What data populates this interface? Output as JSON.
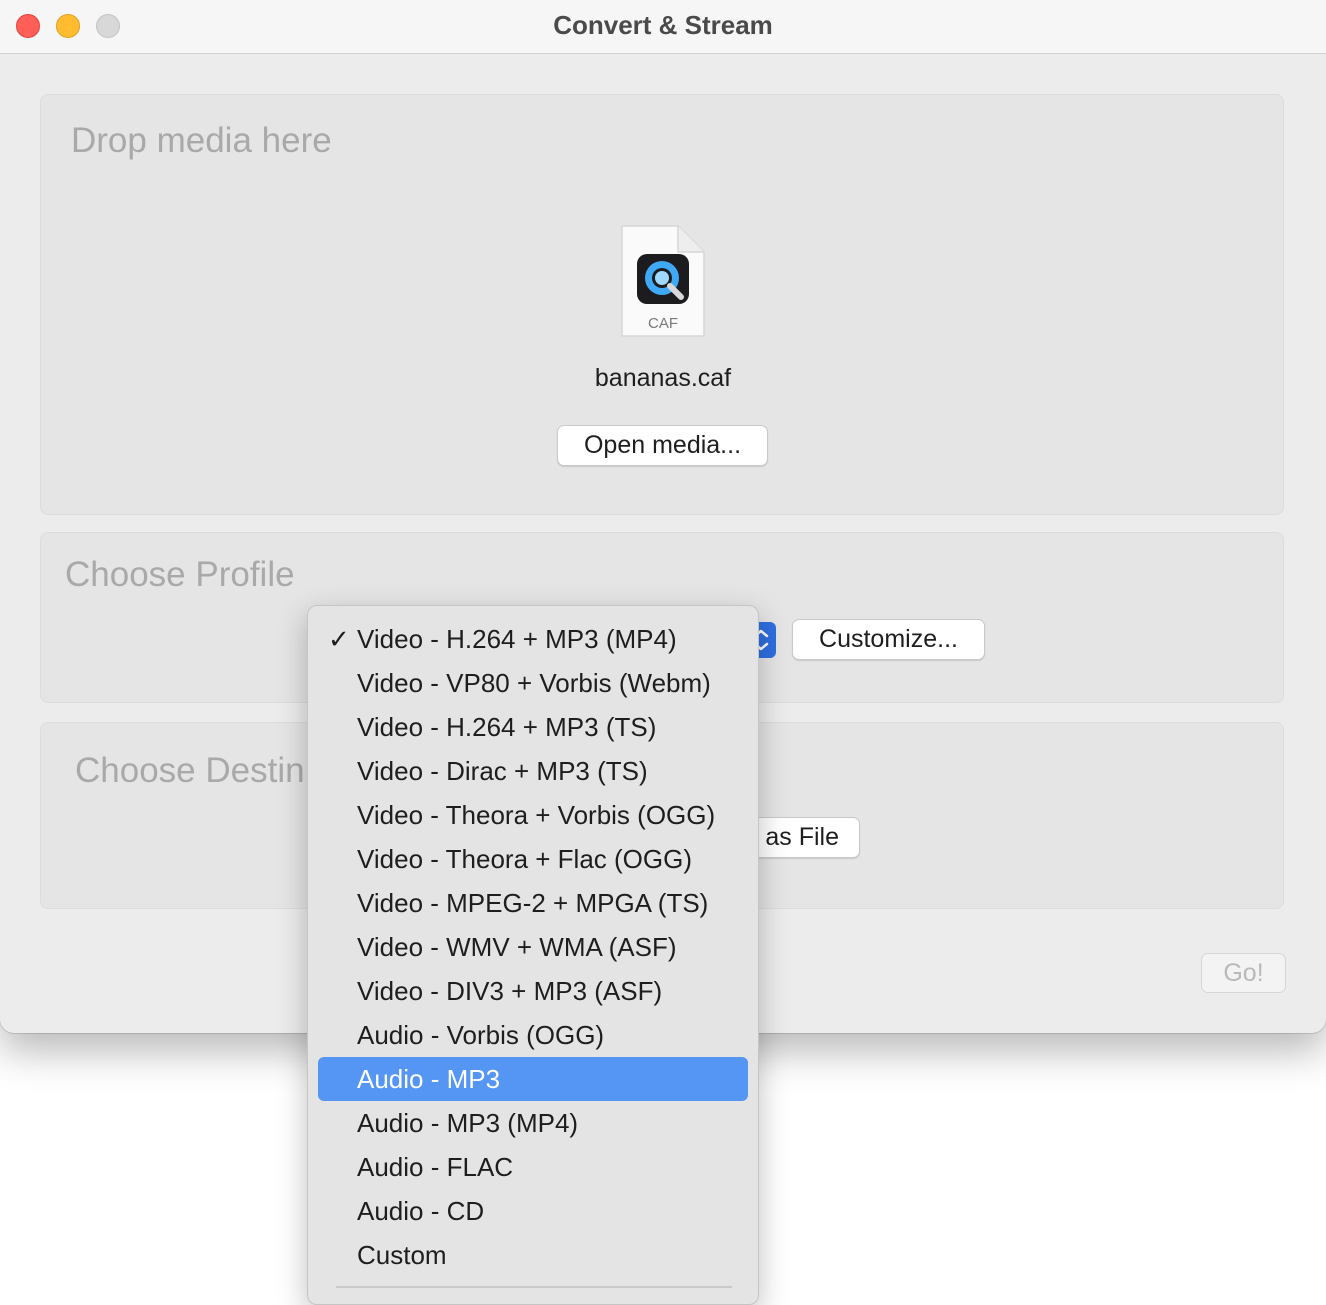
{
  "window": {
    "title": "Convert & Stream"
  },
  "drop_panel": {
    "heading": "Drop media here",
    "file_icon_label": "CAF",
    "file_name": "bananas.caf",
    "open_button": "Open media..."
  },
  "profile_panel": {
    "heading": "Choose Profile",
    "customize_button": "Customize..."
  },
  "destination_panel": {
    "heading_visible": "Choose Destin",
    "save_button_visible": "as File"
  },
  "go_button": "Go!",
  "profile_menu": {
    "checked_index": 0,
    "highlighted_index": 10,
    "items": [
      {
        "label": "Video - H.264 + MP3 (MP4)",
        "check": "✓"
      },
      {
        "label": "Video - VP80 + Vorbis (Webm)",
        "check": ""
      },
      {
        "label": "Video - H.264 + MP3 (TS)",
        "check": ""
      },
      {
        "label": "Video - Dirac + MP3 (TS)",
        "check": ""
      },
      {
        "label": "Video - Theora + Vorbis (OGG)",
        "check": ""
      },
      {
        "label": "Video - Theora + Flac (OGG)",
        "check": ""
      },
      {
        "label": "Video - MPEG-2 + MPGA (TS)",
        "check": ""
      },
      {
        "label": "Video - WMV + WMA (ASF)",
        "check": ""
      },
      {
        "label": "Video - DIV3 + MP3 (ASF)",
        "check": ""
      },
      {
        "label": "Audio - Vorbis (OGG)",
        "check": ""
      },
      {
        "label": "Audio - MP3",
        "check": ""
      },
      {
        "label": "Audio - MP3 (MP4)",
        "check": ""
      },
      {
        "label": "Audio - FLAC",
        "check": ""
      },
      {
        "label": "Audio - CD",
        "check": ""
      },
      {
        "label": "Custom",
        "check": ""
      }
    ]
  },
  "colors": {
    "highlight": "#5596f5",
    "popup_accent": "#2f6fe0",
    "close": "#ff5f57",
    "minimize": "#febc2e"
  },
  "icons": {
    "file": "quicktime-document-icon",
    "popup": "chevron-updown-icon"
  }
}
